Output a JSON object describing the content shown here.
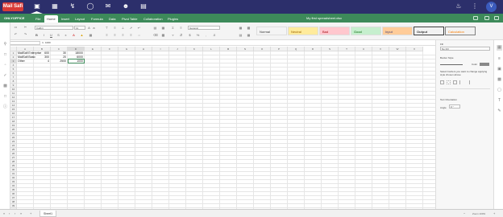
{
  "app": {
    "logo_text": "Mail Safi",
    "user_initial": "V",
    "brand": "ONLYOFFICE",
    "document_title": "My first spreadsheet.xlsx"
  },
  "top_nav_icons": [
    "folder-icon",
    "image-icon",
    "bolt-icon",
    "chat-icon",
    "mail-icon",
    "users-icon",
    "calendar-icon",
    "bell-icon",
    "apps-icon"
  ],
  "menu_tabs": [
    {
      "label": "File",
      "active": false
    },
    {
      "label": "Home",
      "active": true
    },
    {
      "label": "Insert",
      "active": false
    },
    {
      "label": "Layout",
      "active": false
    },
    {
      "label": "Formula",
      "active": false
    },
    {
      "label": "Data",
      "active": false
    },
    {
      "label": "Pivot Table",
      "active": false
    },
    {
      "label": "Collaboration",
      "active": false
    },
    {
      "label": "Plugins",
      "active": false
    }
  ],
  "toolbar": {
    "font_name": "Calibri",
    "font_size": "11",
    "number_format": "General",
    "cell_styles": [
      {
        "label": "Normal",
        "bg": "#ffffff",
        "color": "#333333"
      },
      {
        "label": "Neutral",
        "bg": "#ffeb9c",
        "color": "#9c6500"
      },
      {
        "label": "Bad",
        "bg": "#ffc7ce",
        "color": "#9c0006"
      },
      {
        "label": "Good",
        "bg": "#c6efce",
        "color": "#006100"
      },
      {
        "label": "Input",
        "bg": "#ffcc99",
        "color": "#3f3f76"
      },
      {
        "label": "Output",
        "bg": "#f2f2f2",
        "color": "#3f3f3f"
      },
      {
        "label": "Calculation",
        "bg": "#f2f2f2",
        "color": "#fa7d00"
      }
    ]
  },
  "formula_bar": {
    "cell_ref": "D3",
    "fx": "fx",
    "value": "1000"
  },
  "sheet": {
    "columns": [
      "A",
      "B",
      "C",
      "D",
      "E",
      "F",
      "G",
      "H",
      "I",
      "J",
      "K",
      "L",
      "M",
      "N",
      "O",
      "P",
      "Q",
      "R",
      "S",
      "T",
      "U",
      "V",
      "W",
      "X"
    ],
    "selected_column": "D",
    "row_count": 40,
    "selected_row": 3,
    "cells": [
      {
        "row": 1,
        "col": "A",
        "value": "MailSafi Enterprise",
        "num": false
      },
      {
        "row": 1,
        "col": "B",
        "value": "600",
        "num": true
      },
      {
        "row": 1,
        "col": "C",
        "value": "30",
        "num": true
      },
      {
        "row": 1,
        "col": "D",
        "value": "18000",
        "num": true
      },
      {
        "row": 2,
        "col": "A",
        "value": "MailSafi Basic",
        "num": false
      },
      {
        "row": 2,
        "col": "B",
        "value": "300",
        "num": true
      },
      {
        "row": 2,
        "col": "C",
        "value": "20",
        "num": true
      },
      {
        "row": 2,
        "col": "D",
        "value": "6000",
        "num": true
      },
      {
        "row": 3,
        "col": "A",
        "value": "Other",
        "num": false
      },
      {
        "row": 3,
        "col": "B",
        "value": "4",
        "num": true
      },
      {
        "row": 3,
        "col": "C",
        "value": "2500",
        "num": true
      },
      {
        "row": 3,
        "col": "D",
        "value": "1000",
        "num": true
      }
    ]
  },
  "right_panel": {
    "fill_label": "Fill",
    "fill_value": "No Fill",
    "border_style_label": "Border Style",
    "color_label": "Color",
    "border_hint": "Select borders you want to change applying style chosen above",
    "text_orientation_label": "Text Orientation",
    "angle_label": "Angle",
    "angle_value": "0 °"
  },
  "bottom_bar": {
    "sheet_tab": "Sheet1",
    "zoom": "Zoom 100%"
  }
}
